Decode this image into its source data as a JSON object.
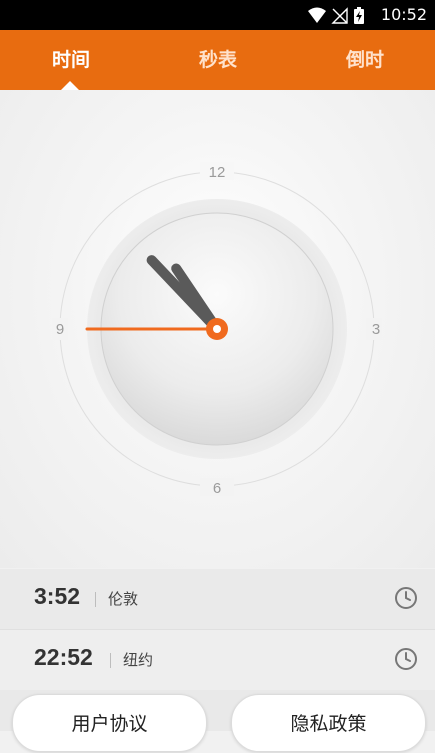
{
  "status_bar": {
    "time": "10:52",
    "icons": [
      "wifi-icon",
      "no-signal-icon",
      "battery-charging-icon"
    ]
  },
  "tabs": [
    {
      "label": "时间",
      "active": true
    },
    {
      "label": "秒表",
      "active": false
    },
    {
      "label": "倒时",
      "active": false
    }
  ],
  "clock": {
    "dial_numbers": {
      "twelve": "12",
      "three": "3",
      "six": "6",
      "nine": "9"
    },
    "hour": 10,
    "minute": 52,
    "second": 45,
    "accent_color": "#f06a1e"
  },
  "world_clocks": [
    {
      "time": "3:52",
      "city": "伦敦",
      "icon": "clock-icon"
    },
    {
      "time": "22:52",
      "city": "纽约",
      "icon": "clock-icon"
    }
  ],
  "footer": {
    "user_agreement": "用户协议",
    "privacy_policy": "隐私政策"
  },
  "colors": {
    "brand": "#e86c10",
    "hands": "#5a5a5a"
  }
}
